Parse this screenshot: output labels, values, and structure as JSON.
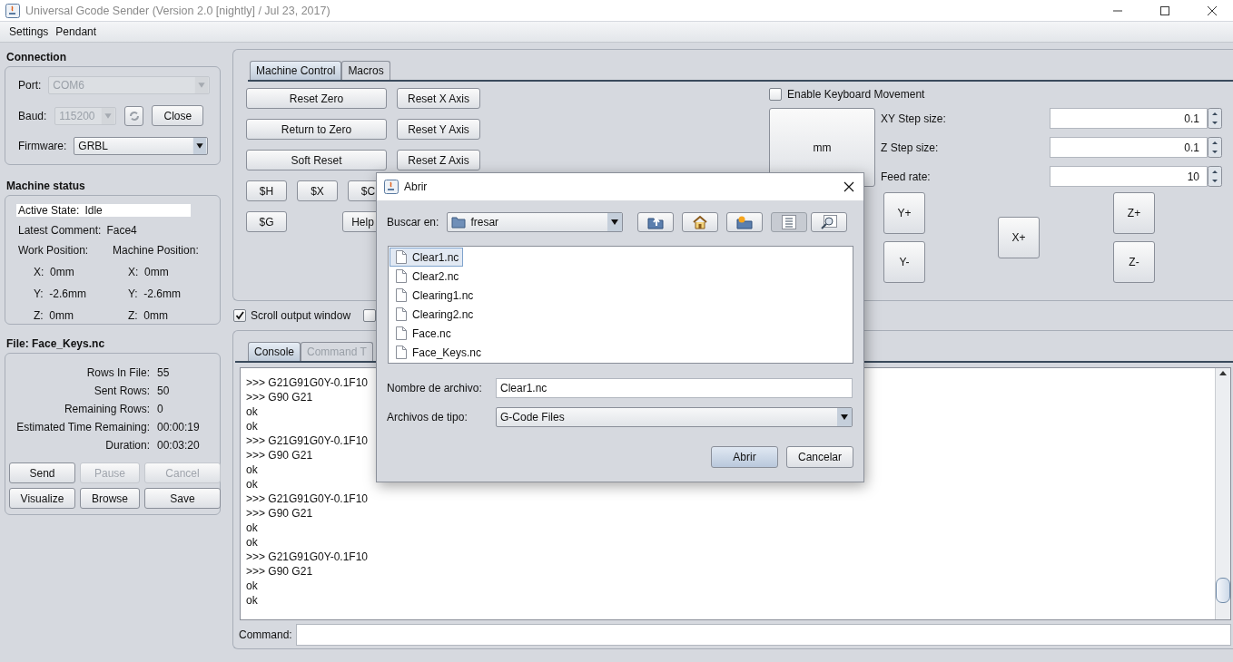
{
  "window": {
    "title": "Universal Gcode Sender (Version 2.0 [nightly]  / Jul 23, 2017)"
  },
  "menu": [
    "Settings",
    "Pendant"
  ],
  "connection": {
    "title": "Connection",
    "port": {
      "label": "Port:",
      "value": "COM6",
      "disabled": true
    },
    "baud": {
      "label": "Baud:",
      "value": "115200",
      "disabled": true
    },
    "close_button": "Close",
    "firmware": {
      "label": "Firmware:",
      "value": "GRBL",
      "disabled": false
    }
  },
  "machine_status": {
    "title": "Machine status",
    "active_state": {
      "label": "Active State:",
      "value": "Idle"
    },
    "latest_comment": {
      "label": "Latest Comment:",
      "value": "Face4"
    },
    "work_position": {
      "title": "Work Position:",
      "axes": [
        {
          "label": "X:",
          "value": "0mm"
        },
        {
          "label": "Y:",
          "value": "-2.6mm"
        },
        {
          "label": "Z:",
          "value": "0mm"
        }
      ]
    },
    "machine_position": {
      "title": "Machine Position:",
      "axes": [
        {
          "label": "X:",
          "value": "0mm"
        },
        {
          "label": "Y:",
          "value": "-2.6mm"
        },
        {
          "label": "Z:",
          "value": "0mm"
        }
      ]
    }
  },
  "file": {
    "title": "File: Face_Keys.nc",
    "stats": [
      {
        "label": "Rows In File:",
        "value": "55"
      },
      {
        "label": "Sent Rows:",
        "value": "50"
      },
      {
        "label": "Remaining Rows:",
        "value": "0"
      },
      {
        "label": "Estimated Time Remaining:",
        "value": "00:00:19"
      },
      {
        "label": "Duration:",
        "value": "00:03:20"
      }
    ],
    "buttons": [
      {
        "label": "Send",
        "disabled": false
      },
      {
        "label": "Pause",
        "disabled": true
      },
      {
        "label": "Cancel",
        "disabled": true
      },
      {
        "label": "Visualize",
        "disabled": false
      },
      {
        "label": "Browse",
        "disabled": false
      },
      {
        "label": "Save",
        "disabled": false
      }
    ]
  },
  "control_tabs": [
    {
      "label": "Machine Control",
      "selected": true
    },
    {
      "label": "Macros",
      "selected": false
    }
  ],
  "machine_control": {
    "buttons": [
      [
        "Reset Zero",
        "Reset X Axis"
      ],
      [
        "Return to Zero",
        "Reset Y Axis"
      ],
      [
        "Soft Reset",
        "Reset Z Axis"
      ]
    ],
    "command_buttons": [
      [
        "$H",
        "$X",
        "$C"
      ],
      [
        "$G",
        "Help"
      ]
    ]
  },
  "jog": {
    "keyboard": {
      "label": "Enable Keyboard Movement",
      "checked": false
    },
    "unit_button": "mm",
    "fields": [
      {
        "label": "XY Step size:",
        "value": "0.1"
      },
      {
        "label": "Z Step size:",
        "value": "0.1"
      },
      {
        "label": "Feed rate:",
        "value": "10"
      }
    ],
    "buttons": [
      "Y+",
      "Y-",
      "X+",
      "Z+",
      "Z-"
    ]
  },
  "scroll_output": {
    "label": "Scroll output window",
    "checked": true
  },
  "second_checkbox": {
    "checked": false
  },
  "console_tabs": [
    {
      "label": "Console",
      "selected": true
    },
    {
      "label": "Command T",
      "selected": false
    }
  ],
  "console_lines": [
    ">>> G21G91G0Y-0.1F10",
    ">>> G90 G21",
    "ok",
    "ok",
    ">>> G21G91G0Y-0.1F10",
    ">>> G90 G21",
    "ok",
    "ok",
    ">>> G21G91G0Y-0.1F10",
    ">>> G90 G21",
    "ok",
    "ok",
    ">>> G21G91G0Y-0.1F10",
    ">>> G90 G21",
    "ok",
    "ok"
  ],
  "command": {
    "label": "Command:"
  },
  "dialog": {
    "title": "Abrir",
    "look_in": {
      "label": "Buscar en:",
      "value": "fresar"
    },
    "toolbar": [
      {
        "kind": "up",
        "selected": false
      },
      {
        "kind": "home",
        "selected": false
      },
      {
        "kind": "new-folder",
        "selected": false
      },
      {
        "kind": "list",
        "selected": true
      },
      {
        "kind": "details",
        "selected": false
      }
    ],
    "files": [
      {
        "name": "Clear1.nc",
        "selected": true
      },
      {
        "name": "Clear2.nc",
        "selected": false
      },
      {
        "name": "Clearing1.nc",
        "selected": false
      },
      {
        "name": "Clearing2.nc",
        "selected": false
      },
      {
        "name": "Face.nc",
        "selected": false
      },
      {
        "name": "Face_Keys.nc",
        "selected": false
      }
    ],
    "file_name": {
      "label": "Nombre de archivo:",
      "value": "Clear1.nc"
    },
    "file_type": {
      "label": "Archivos de tipo:",
      "value": "G-Code Files"
    },
    "buttons": [
      {
        "label": "Abrir",
        "kind": "default"
      },
      {
        "label": "Cancelar",
        "kind": "normal"
      }
    ]
  }
}
